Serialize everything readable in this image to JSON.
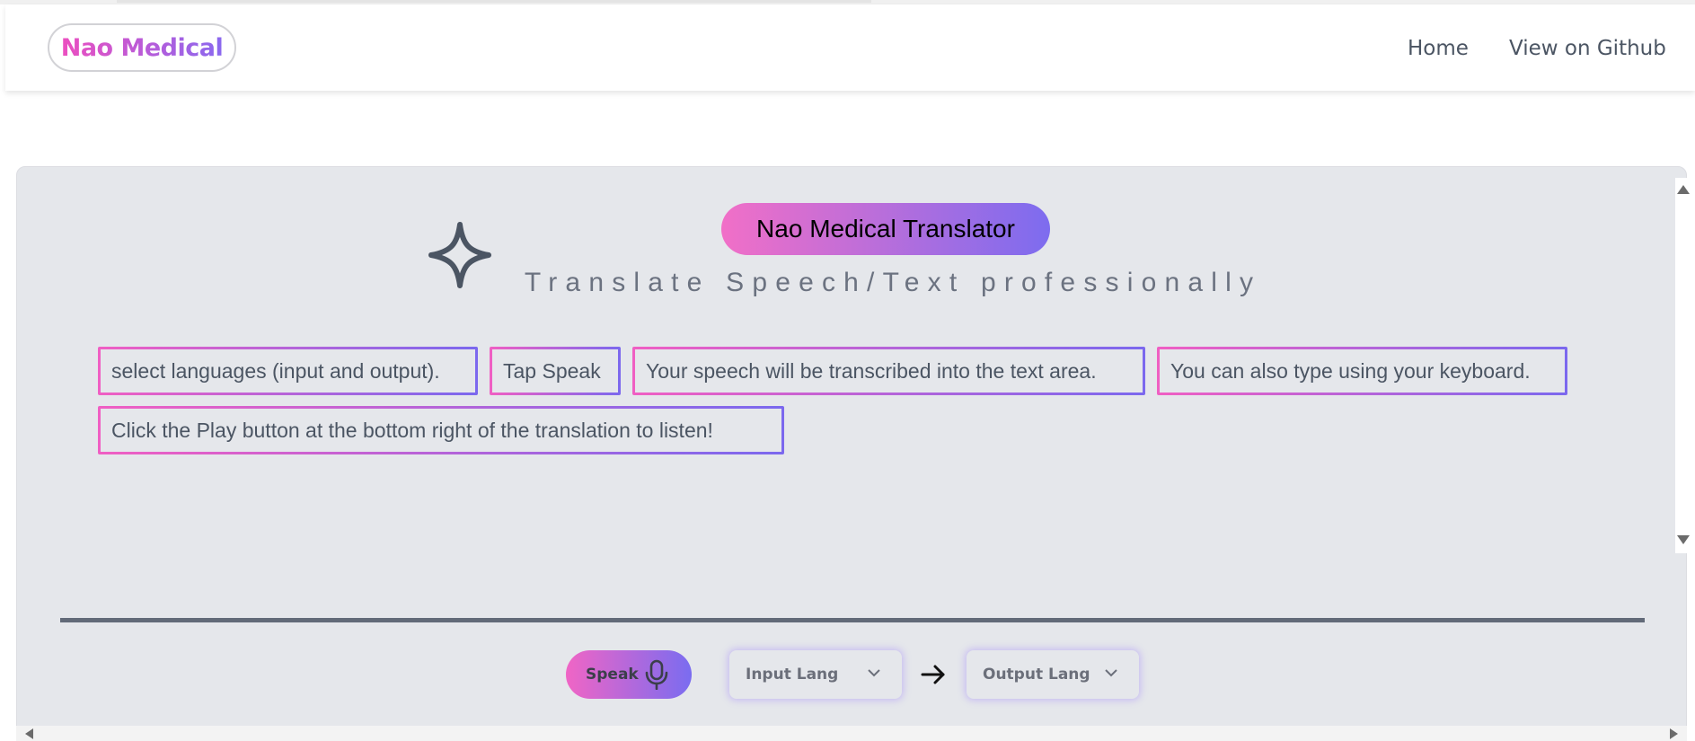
{
  "header": {
    "brand": "Nao Medical",
    "nav": {
      "home": "Home",
      "github": "View on Github"
    }
  },
  "hero": {
    "title": "Nao Medical Translator",
    "subtitle": "Translate Speech/Text professionally",
    "icon": "sparkle-icon"
  },
  "instructions": [
    "select languages (input and output).",
    "Tap Speak",
    "Your speech will be transcribed into the text area.",
    "You can also type using your keyboard.",
    "Click the Play button at the bottom right of the translation to listen!"
  ],
  "controls": {
    "speak_label": "Speak",
    "speak_icon": "microphone-icon",
    "input_lang_placeholder": "Input Lang",
    "output_lang_placeholder": "Output Lang",
    "arrow_icon": "arrow-right-icon"
  },
  "colors": {
    "gradient_start": "#f16fc7",
    "gradient_end": "#7d6cef",
    "panel_bg": "#e5e7eb",
    "text_muted": "#4b5563"
  }
}
